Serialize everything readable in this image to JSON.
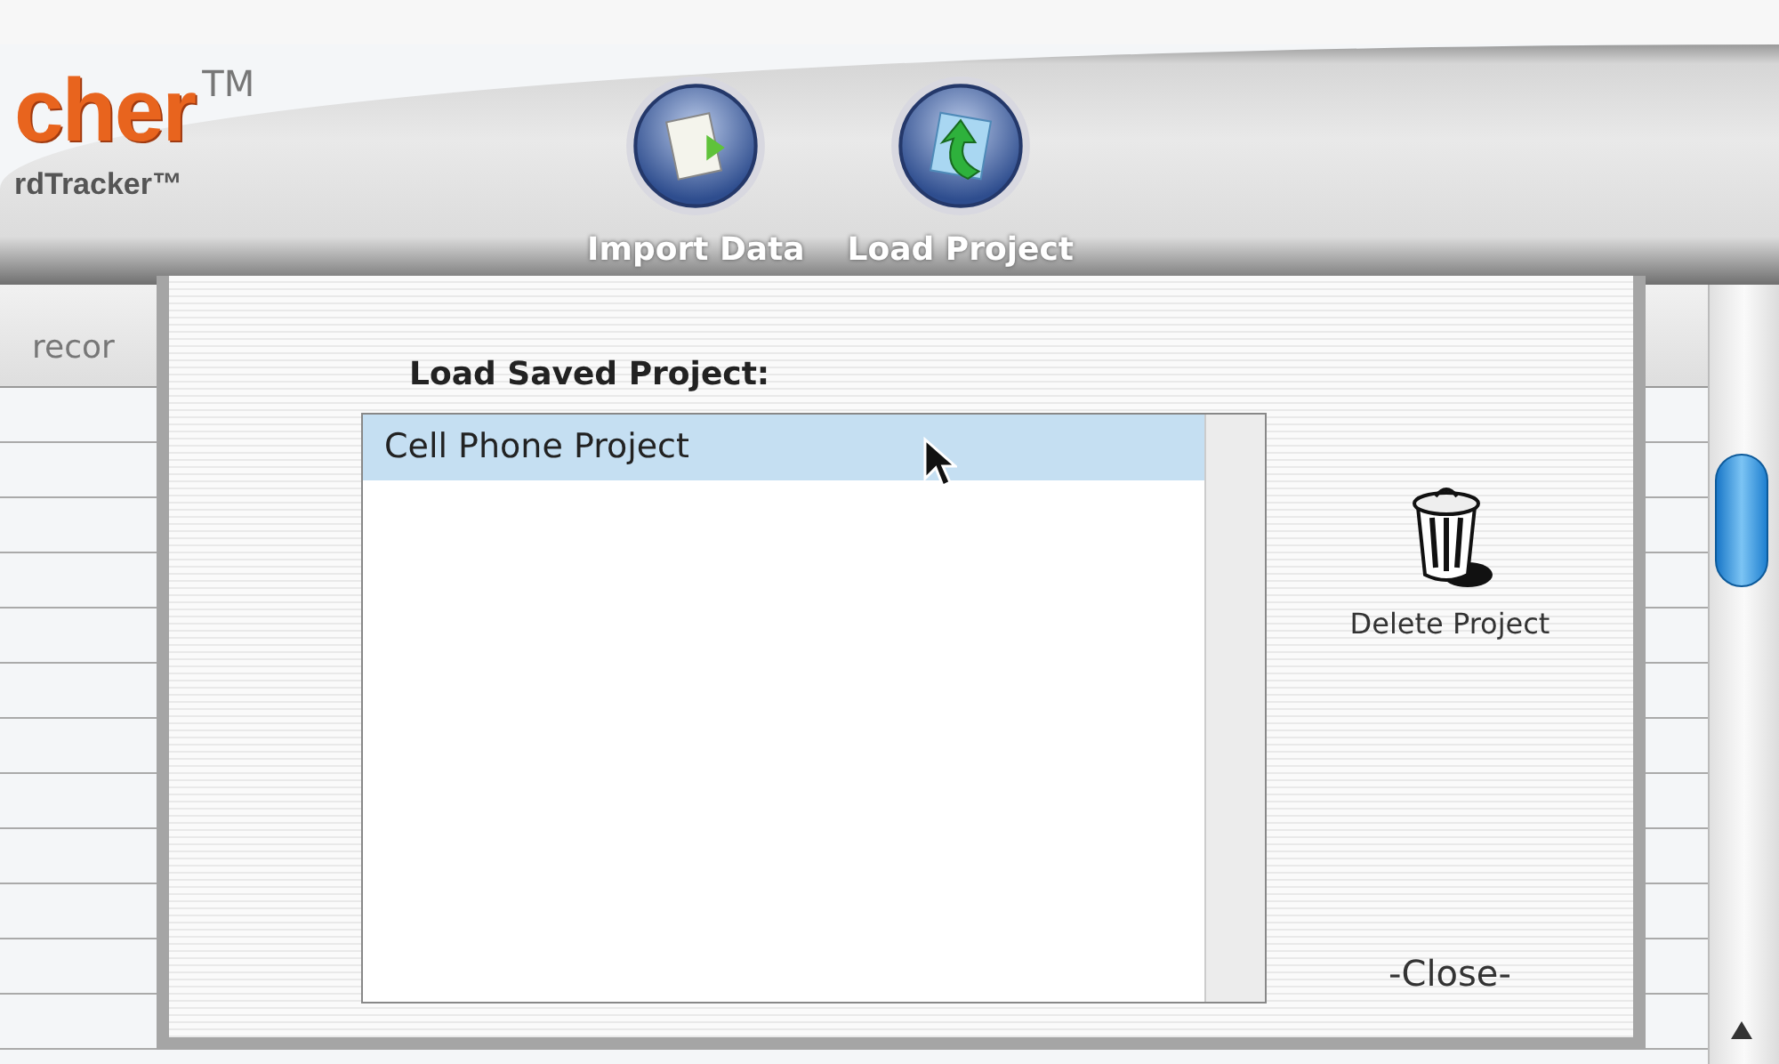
{
  "logo": {
    "name": "cher",
    "trademark": "TM",
    "subtitle": "rdTracker™"
  },
  "toolbar": [
    {
      "label": "Import Data",
      "kind": "import"
    },
    {
      "label": "Load Project",
      "kind": "load"
    }
  ],
  "background_table": {
    "column_header": "recor"
  },
  "dialog": {
    "title": "Load Saved Project:",
    "projects": [
      {
        "name": "Cell Phone Project",
        "selected": true
      }
    ],
    "delete_label": "Delete Project",
    "close_label": "-Close-"
  }
}
